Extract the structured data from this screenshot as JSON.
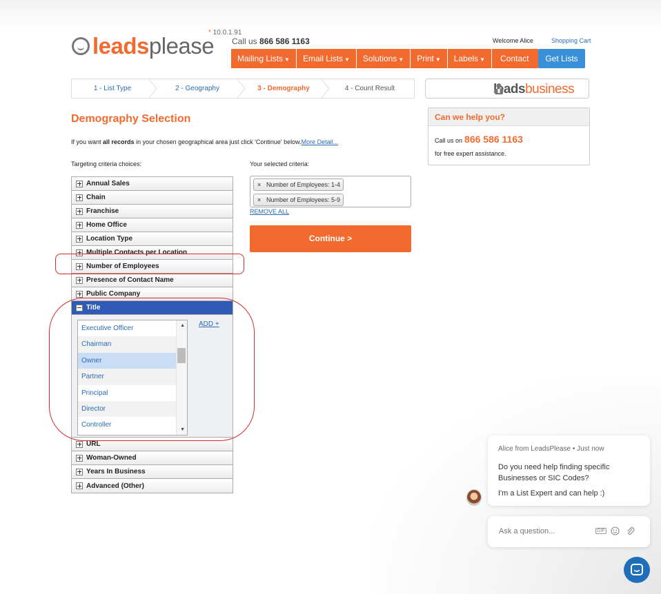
{
  "header": {
    "logo": {
      "part1": "leads",
      "part2": "please"
    },
    "version": "10.0.1.91",
    "callus_prefix": "Call us",
    "phone": "866 586 1163",
    "welcome": "Welcome Alice",
    "cart": "Shopping Cart",
    "menu": [
      "Mailing Lists",
      "Email Lists",
      "Solutions",
      "Print",
      "Labels",
      "Contact"
    ],
    "get_lists": "Get Lists"
  },
  "steps": [
    {
      "label": "1 - List Type",
      "state": "link"
    },
    {
      "label": "2 - Geography",
      "state": "link"
    },
    {
      "label": "3 - Demography",
      "state": "active"
    },
    {
      "label": "4 - Count Result",
      "state": "pending"
    }
  ],
  "brand_box": {
    "part1": "leads",
    "part2": "business"
  },
  "help": {
    "title": "Can we help you?",
    "line1_prefix": "Call us on",
    "phone": "866 586 1163",
    "line2": "for free expert assistance."
  },
  "main": {
    "title": "Demography Selection",
    "intro_1": "If you want ",
    "intro_bold": "all records",
    "intro_2": " in your chosen geographical area just click 'Continue' below.",
    "more_link": "More Detail...",
    "targeting_label": "Targeting criteria choices:",
    "selected_label": "Your selected criteria:"
  },
  "criteria_top": [
    "Annual Sales",
    "Chain",
    "Franchise",
    "Home Office",
    "Location Type",
    "Multiple Contacts per Location",
    "Number of Employees",
    "Presence of Contact Name",
    "Public Company"
  ],
  "criteria_open": "Title",
  "title_options": [
    "Executive Officer",
    "Chairman",
    "Owner",
    "Partner",
    "Principal",
    "Director",
    "Controller"
  ],
  "add_label": "ADD +",
  "criteria_bottom": [
    "URL",
    "Woman-Owned",
    "Years In Business",
    "Advanced (Other)"
  ],
  "selected_criteria": [
    "Number of Employees: 1-4",
    "Number of Employees: 5-9"
  ],
  "remove_all": "REMOVE ALL",
  "continue_label": "Continue >",
  "chat": {
    "meta": "Alice from LeadsPlease • Just now",
    "msg1": "Do you need help finding specific Businesses or SIC Codes?",
    "msg2": "I'm a List Expert and can help :)",
    "placeholder": "Ask a question...",
    "gif": "GIF"
  },
  "colors": {
    "brand_orange": "#f26a2e",
    "link_blue": "#2a6bb5",
    "button_blue": "#3a8fd9",
    "header_blue": "#2f5bb7",
    "annotation_red": "#d42a2a"
  },
  "icons": [
    "plus-icon",
    "minus-icon",
    "remove-x-icon",
    "scroll-up-icon",
    "scroll-down-icon",
    "emoji-icon",
    "attach-icon",
    "chat-icon"
  ]
}
